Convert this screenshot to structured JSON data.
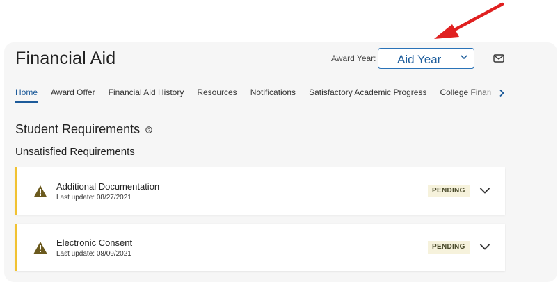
{
  "header": {
    "title": "Financial Aid",
    "award_year_label": "Award Year:",
    "award_year_value": "Aid Year"
  },
  "tabs": [
    {
      "label": "Home",
      "active": true
    },
    {
      "label": "Award Offer"
    },
    {
      "label": "Financial Aid History"
    },
    {
      "label": "Resources"
    },
    {
      "label": "Notifications"
    },
    {
      "label": "Satisfactory Academic Progress"
    },
    {
      "label": "College Finan"
    }
  ],
  "requirements": {
    "heading": "Student Requirements",
    "subheading": "Unsatisfied Requirements",
    "items": [
      {
        "name": "Additional Documentation",
        "updated": "Last update: 08/27/2021",
        "status": "PENDING"
      },
      {
        "name": "Electronic Consent",
        "updated": "Last update: 08/09/2021",
        "status": "PENDING"
      }
    ]
  },
  "icons": {
    "mail": "mail-icon",
    "help": "help-circle-icon",
    "warning": "warning-triangle-icon",
    "expand": "chevron-down-icon",
    "tabs_next": "chevron-right-icon",
    "annotation": "red-arrow-annotation"
  },
  "colors": {
    "accent": "#1d5b9a",
    "warning_border": "#f1c232",
    "warning_icon": "#6b5a1e",
    "badge_bg": "#f6f2dc",
    "annotation_arrow": "#e02020"
  }
}
